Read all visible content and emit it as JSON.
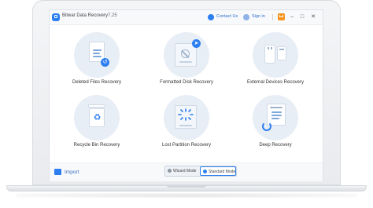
{
  "app": {
    "title": "Bitwar Data Recovery",
    "version": "7.25"
  },
  "titlebar": {
    "contact_label": "Contact Us",
    "signin_label": "Sign in",
    "minimize_glyph": "–",
    "maximize_glyph": "□",
    "close_glyph": "✕"
  },
  "tiles": [
    {
      "label": "Deleted Files Recovery",
      "icon": "deleted-files-icon"
    },
    {
      "label": "Formatted Disk Recovery",
      "icon": "formatted-disk-icon"
    },
    {
      "label": "External Devices Recovery",
      "icon": "external-devices-icon"
    },
    {
      "label": "Recycle Bin Recovery",
      "icon": "recycle-bin-icon"
    },
    {
      "label": "Lost Partition Recovery",
      "icon": "lost-partition-icon"
    },
    {
      "label": "Deep Recovery",
      "icon": "deep-recovery-icon"
    }
  ],
  "bottom": {
    "import_label": "Import",
    "wizard_mode_label": "Wizard Mode",
    "standard_mode_label": "Standard Mode",
    "active_mode": "Standard Mode"
  },
  "colors": {
    "accent": "#2d7ff0",
    "tile_circle": "#e8eef5",
    "cart": "#f7931e"
  }
}
